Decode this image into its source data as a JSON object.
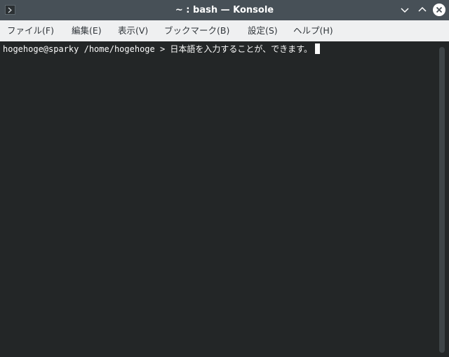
{
  "window": {
    "title": "~ : bash — Konsole",
    "icons": {
      "app": "terminal-app-icon",
      "minimize": "chevron-down-icon",
      "maximize": "chevron-up-icon",
      "close": "close-icon"
    }
  },
  "menubar": {
    "file": "ファイル(F)",
    "edit": "編集(E)",
    "view": "表示(V)",
    "bookmarks": "ブックマーク(B)",
    "settings": "設定(S)",
    "help": "ヘルプ(H)"
  },
  "terminal": {
    "prompt": "hogehoge@sparky /home/hogehoge >",
    "input": "日本語を入力することが、できます。"
  },
  "colors": {
    "titlebar": "#475057",
    "menubar": "#eff0f1",
    "terminal_bg": "#232627",
    "terminal_fg": "#fcfcfc"
  }
}
